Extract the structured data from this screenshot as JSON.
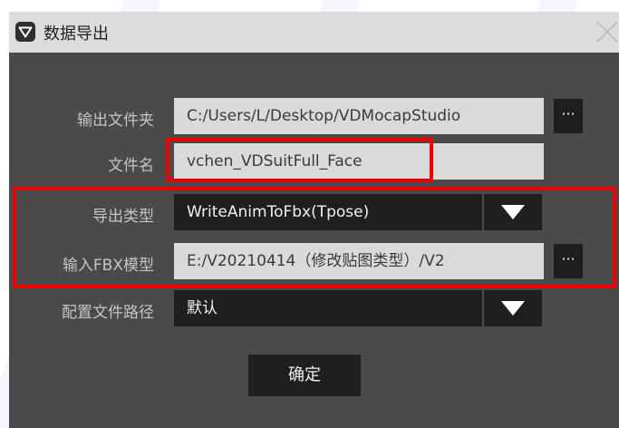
{
  "window": {
    "title": "数据导出"
  },
  "form": {
    "output_folder": {
      "label": "输出文件夹",
      "value": "C:/Users/L/Desktop/VDMocapStudio",
      "browse_label": "···"
    },
    "file_name": {
      "label": "文件名",
      "value": "vchen_VDSuitFull_Face"
    },
    "export_type": {
      "label": "导出类型",
      "value": "WriteAnimToFbx(Tpose)"
    },
    "input_fbx": {
      "label": "输入FBX模型",
      "value": "E:/V20210414（修改贴图类型）/V2",
      "browse_label": "···"
    },
    "config_path": {
      "label": "配置文件路径",
      "value": "默认"
    }
  },
  "confirm_label": "确定",
  "colors": {
    "dialog_bg": "#4a4a4a",
    "titlebar_bg": "#dcdcdc",
    "field_light": "#dadada",
    "field_dark": "#1f1f1f",
    "highlight": "#ee0000"
  }
}
